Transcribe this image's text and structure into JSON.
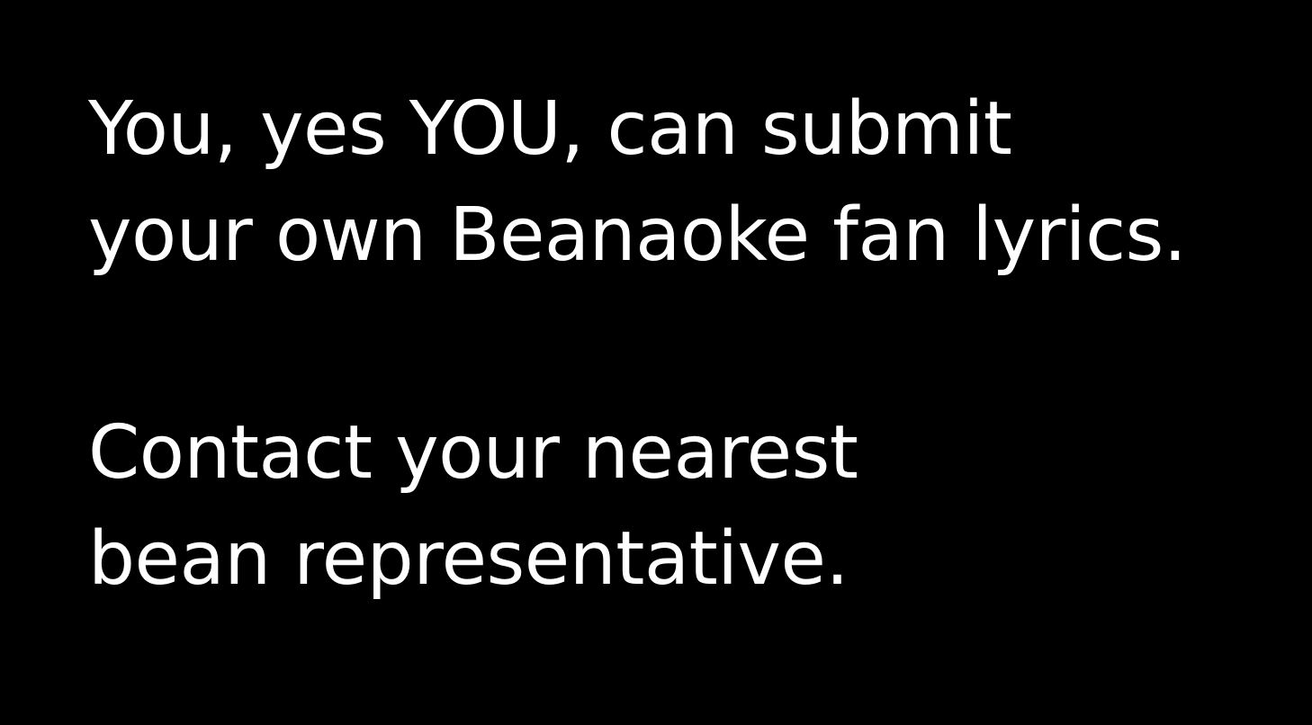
{
  "slide": {
    "background_color": "#000000",
    "text_color": "#ffffff",
    "paragraph_1": {
      "line_1": "You, yes YOU, can submit",
      "line_2": "your own Beanaoke fan lyrics."
    },
    "paragraph_2": {
      "line_1": "Contact your nearest",
      "line_2": "bean representative."
    }
  }
}
